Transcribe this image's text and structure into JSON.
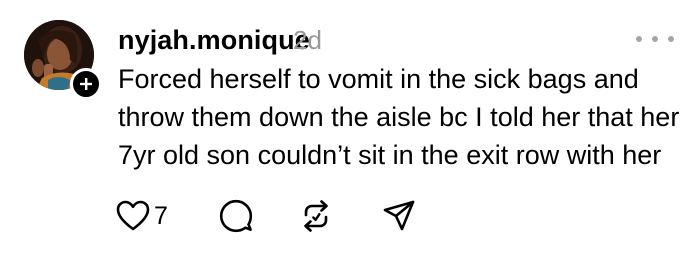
{
  "post": {
    "username": "nyjah.monique",
    "timestamp": "2d",
    "lines": [
      "Forced herself to vomit in the sick bags and",
      "throw them down the aisle bc I told her that her",
      "7yr old son couldn’t sit in the exit row with her"
    ],
    "like_count": "7"
  },
  "icons": {
    "more": "more-horizontal-icon",
    "like": "heart-icon",
    "reply": "comment-bubble-icon",
    "repost": "repost-icon",
    "share": "send-icon",
    "follow": "plus-icon"
  },
  "colors": {
    "text": "#000000",
    "muted": "#999999",
    "more_dots": "#a6a6a6"
  }
}
